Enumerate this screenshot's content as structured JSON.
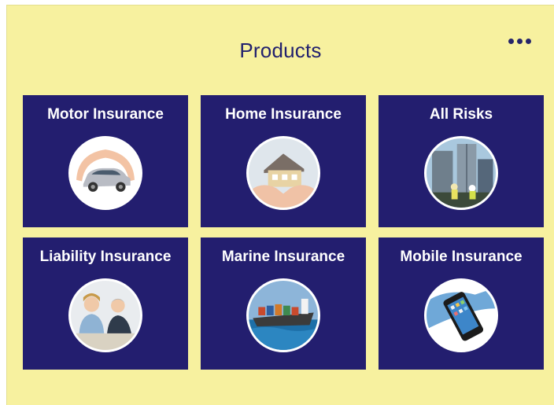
{
  "header": {
    "title": "Products",
    "more_icon": "more-horizontal-icon"
  },
  "colors": {
    "background": "#f7f19f",
    "card": "#231e6f",
    "title_text": "#22216e",
    "card_text": "#ffffff"
  },
  "products": [
    {
      "label": "Motor Insurance",
      "icon": "car-in-hands-image"
    },
    {
      "label": "Home Insurance",
      "icon": "house-in-hands-image"
    },
    {
      "label": "All Risks",
      "icon": "construction-site-image"
    },
    {
      "label": "Liability Insurance",
      "icon": "business-meeting-image"
    },
    {
      "label": "Marine Insurance",
      "icon": "cargo-ship-image"
    },
    {
      "label": "Mobile Insurance",
      "icon": "smartphone-image"
    }
  ]
}
